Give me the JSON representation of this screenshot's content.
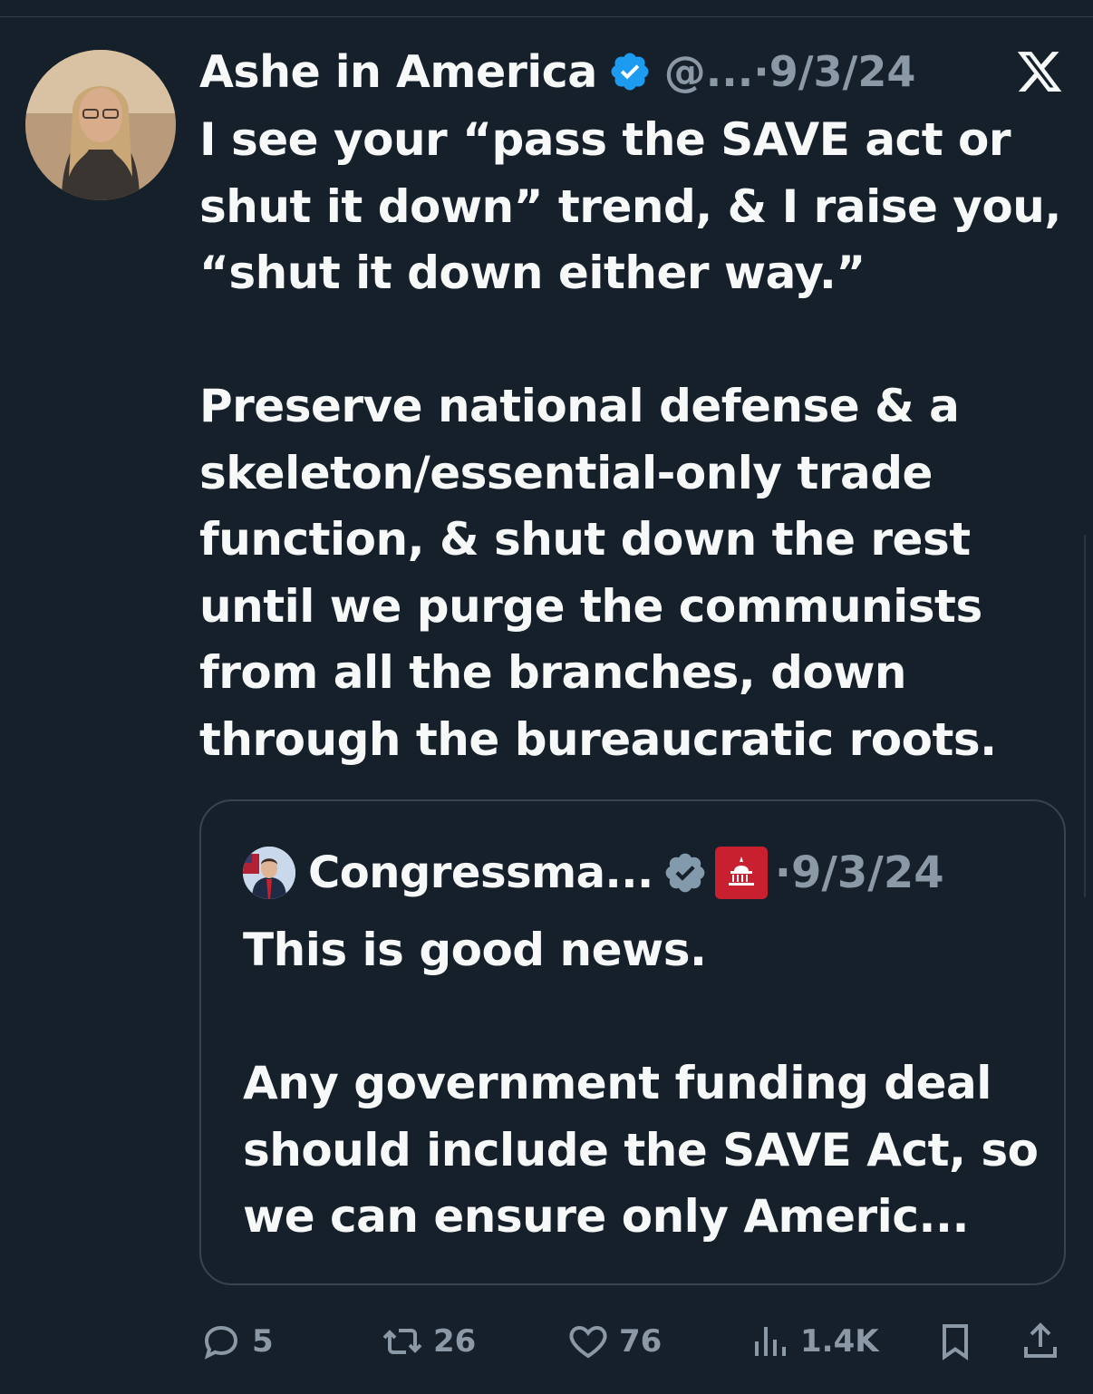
{
  "tweet": {
    "author_name": "Ashe in America",
    "handle": "@...",
    "date": "·9/3/24",
    "text": "I see your “pass the SAVE act or shut it down” trend, & I raise you, “shut it down either way.”\n\nPreserve national defense & a skeleton/essential-only trade function, & shut down the rest until we purge the communists from all the branches, down through the bureaucratic roots."
  },
  "quote": {
    "author_name": "Congressma...",
    "date": "·9/3/24",
    "text": "This is good news.\n\nAny government funding deal should include the SAVE Act, so we can ensure only Americ..."
  },
  "actions": {
    "replies": "5",
    "retweets": "26",
    "likes": "76",
    "views": "1.4K"
  },
  "icons": {
    "verified": "verified-badge-icon",
    "platform": "x-logo-icon",
    "reply": "reply-icon",
    "retweet": "retweet-icon",
    "like": "heart-icon",
    "views": "views-icon",
    "bookmark": "bookmark-icon",
    "share": "share-icon",
    "affiliation": "house-gop-badge-icon"
  },
  "colors": {
    "background": "#15202b",
    "text": "#f7f9f9",
    "muted": "#8b98a5",
    "verified_blue": "#1d9bf0",
    "verified_gray": "#829aab",
    "gop_red": "#c8202f"
  }
}
